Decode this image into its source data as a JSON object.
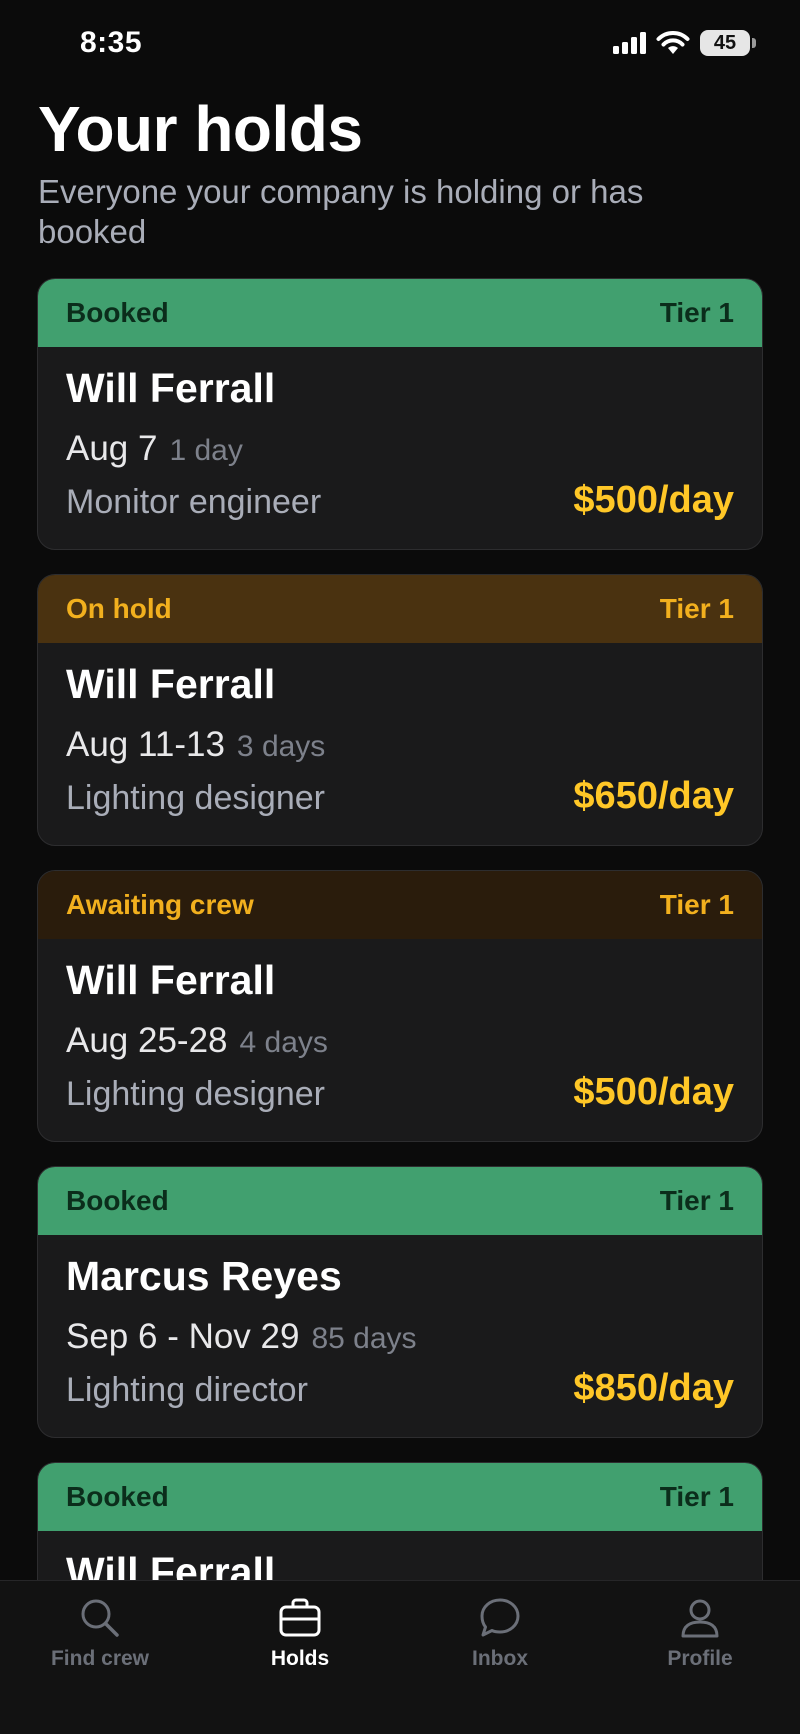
{
  "status_bar": {
    "time": "8:35",
    "battery": "45"
  },
  "header": {
    "title": "Your holds",
    "subtitle": "Everyone your company is holding or has booked"
  },
  "colors": {
    "booked": "#41a06f",
    "on_hold": "#4a3210",
    "awaiting": "#2a1c0c",
    "rate": "#ffc727"
  },
  "holds": [
    {
      "status": "Booked",
      "tier": "Tier 1",
      "name": "Will Ferrall",
      "dates": "Aug 7",
      "duration": "1 day",
      "role": "Monitor engineer",
      "rate": "$500/day"
    },
    {
      "status": "On hold",
      "tier": "Tier 1",
      "name": "Will Ferrall",
      "dates": "Aug 11-13",
      "duration": "3 days",
      "role": "Lighting designer",
      "rate": "$650/day"
    },
    {
      "status": "Awaiting crew",
      "tier": "Tier 1",
      "name": "Will Ferrall",
      "dates": "Aug 25-28",
      "duration": "4 days",
      "role": "Lighting designer",
      "rate": "$500/day"
    },
    {
      "status": "Booked",
      "tier": "Tier 1",
      "name": "Marcus Reyes",
      "dates": "Sep 6 - Nov 29",
      "duration": "85 days",
      "role": "Lighting director",
      "rate": "$850/day"
    },
    {
      "status": "Booked",
      "tier": "Tier 1",
      "name": "Will Ferrall"
    }
  ],
  "tab_bar": {
    "active": "holds",
    "tabs": [
      {
        "id": "find-crew",
        "label": "Find crew",
        "icon": "search-icon"
      },
      {
        "id": "holds",
        "label": "Holds",
        "icon": "briefcase-icon"
      },
      {
        "id": "inbox",
        "label": "Inbox",
        "icon": "chat-bubble-icon"
      },
      {
        "id": "profile",
        "label": "Profile",
        "icon": "person-icon"
      }
    ]
  }
}
